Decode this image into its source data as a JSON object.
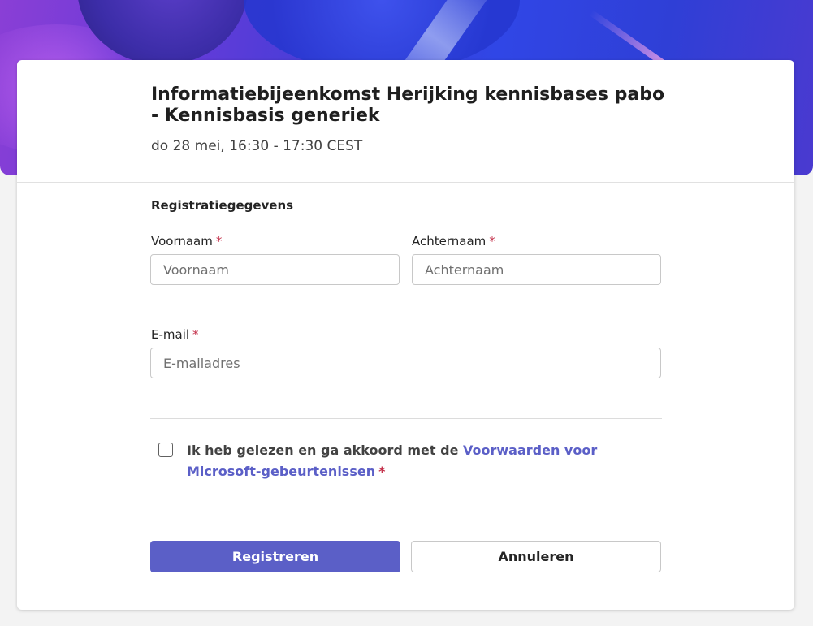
{
  "event": {
    "title": "Informatiebijeenkomst Herijking kennisbases pabo - Kennisbasis generiek",
    "datetime": "do 28 mei, 16:30 - 17:30 CEST"
  },
  "form": {
    "section_title": "Registratiegegevens",
    "required_marker": "*",
    "first_name": {
      "label": "Voornaam",
      "placeholder": "Voornaam",
      "value": ""
    },
    "last_name": {
      "label": "Achternaam",
      "placeholder": "Achternaam",
      "value": ""
    },
    "email": {
      "label": "E-mail",
      "placeholder": "E-mailadres",
      "value": ""
    },
    "consent": {
      "text": "Ik heb gelezen en ga akkoord met de ",
      "link_text": "Voorwaarden voor Microsoft-gebeurtenissen",
      "checked": false
    },
    "register_label": "Registreren",
    "cancel_label": "Annuleren"
  },
  "colors": {
    "accent": "#5b5fc7",
    "required": "#c4314b"
  }
}
